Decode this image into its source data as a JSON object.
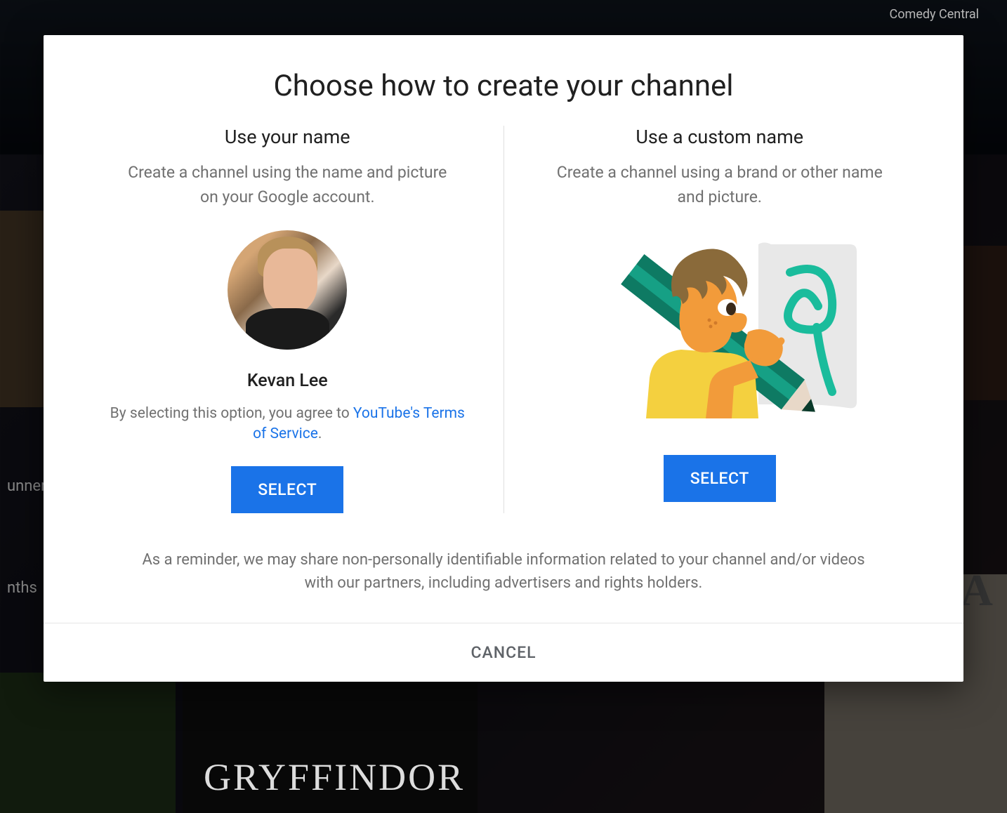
{
  "background": {
    "comedy_label": "Comedy Central",
    "side_text_1": "unner",
    "side_text_2": "nths",
    "gryffindor": "GRYFFINDOR",
    "ba_text": "BA"
  },
  "modal": {
    "title": "Choose how to create your channel",
    "option_personal": {
      "title": "Use your name",
      "description": "Create a channel using the name and picture on your Google account.",
      "user_name": "Kevan Lee",
      "terms_prefix": "By selecting this option, you agree to ",
      "terms_link": "YouTube's Terms of Service",
      "terms_suffix": ".",
      "select_label": "SELECT"
    },
    "option_custom": {
      "title": "Use a custom name",
      "description": "Create a channel using a brand or other name and picture.",
      "select_label": "SELECT"
    },
    "reminder": "As a reminder, we may share non-personally identifiable information related to your channel and/or videos with our partners, including advertisers and rights holders.",
    "cancel_label": "CANCEL"
  }
}
